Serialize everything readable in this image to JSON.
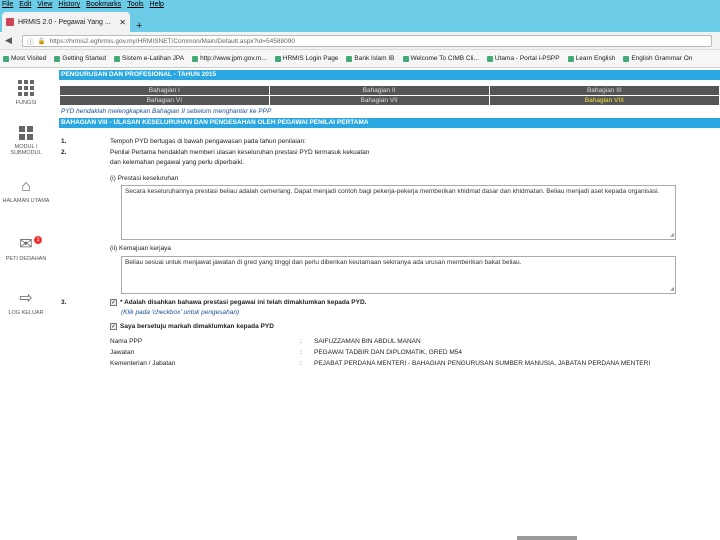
{
  "menu": [
    "File",
    "Edit",
    "View",
    "History",
    "Bookmarks",
    "Tools",
    "Help"
  ],
  "tab": {
    "title": "HRMIS 2.0 - Pegawai Yang ..."
  },
  "newtab_symbol": "+",
  "url": "https://hrmis2.eghrmis.gov.my/HRMISNET/Common/Main/Default.aspx?id=54588090",
  "bookmarks": [
    "Most Visited",
    "Getting Started",
    "Sistem e-Latihan JPA",
    "http://www.jpm.gov.m...",
    "HRMIS Login Page",
    "Bank Islam IB",
    "Welcome To CIMB Cli...",
    "Utama - Portal i-PSPP",
    "Learn English",
    "English Grammar On"
  ],
  "sidebar": [
    {
      "icon": "grid-icon",
      "label": "FUNGSI"
    },
    {
      "icon": "grid-icon",
      "label": "MODUL / SUBMODUL"
    },
    {
      "icon": "home-icon",
      "label": "HALAMAN UTAMA"
    },
    {
      "icon": "mail-icon",
      "label": "PETI DEDAHAN",
      "badge": "1"
    },
    {
      "icon": "logout-icon",
      "label": "LOG KELUAR"
    }
  ],
  "header_bar": "PENGURUSAN DAN PROFESIONAL - TAHUN 2015",
  "parts_row1": [
    "Bahagian I",
    "Bahagian II",
    "Bahagian III"
  ],
  "parts_row2": [
    "Bahagian VI",
    "Bahagian VII",
    "Bahagian VIII"
  ],
  "warning": "PYD hendaklah melengkapkan Bahagian II sebelum menghantar ke PPP",
  "section_bar": "BAHAGIAN VIII - ULASAN KESELURUHAN DAN PENGESAHAN OLEH PEGAWAI PENILAI PERTAMA",
  "q1": {
    "num": "1.",
    "text": "Tempoh PYD bertugas di bawah pengawasan pada tahun penilaian:"
  },
  "q2": {
    "num": "2.",
    "line1": "Penilai Pertama hendaklah memberi ulasan keseluruhan prestasi PYD termasuk kekuatan",
    "line2": "dan kelemahan pegawai yang perlu diperbaiki.",
    "sub_i": "(i)  Prestasi keseluruhan",
    "text_i": "Secara keseluruhannya prestasi beliau adalah cemerlang. Dapat menjadi contoh bagi pekerja-pekerja memberikan khidmat dasar dan khidmatan. Beliau menjadi aset kepada organisasi.",
    "sub_ii": "(ii)  Kemajuan kerjaya",
    "text_ii": "Beliau sesuai untuk menjawat jawatan di gred yang tinggi dan perlu diberikan keutamaan sekiranya ada urusan memberikan bakat beliau."
  },
  "q3": {
    "num": "3.",
    "check1": "* Adalah disahkan bahawa prestasi pegawai ini telah dimaklumkan kepada PYD.",
    "check1_mark": "✓",
    "note": "(Klik pada 'checkbox' untuk pengesahan)",
    "check2": "Saya bersetuju markah dimaklumkan kepada PYD",
    "check2_mark": "✓"
  },
  "info": [
    {
      "k": "Nama PPP",
      "c": ":",
      "v": "SAIFUZZAMAN BIN ABDUL MANAN"
    },
    {
      "k": "Jawatan",
      "c": ":",
      "v": "PEGAWAI TADBIR DAN DIPLOMATIK, GRED M54"
    },
    {
      "k": "Kementerian / Jabatan",
      "c": ":",
      "v": "PEJABAT PERDANA MENTERI - BAHAGIAN PENGURUSAN SUMBER MANUSIA, JABATAN PERDANA MENTERI"
    }
  ]
}
